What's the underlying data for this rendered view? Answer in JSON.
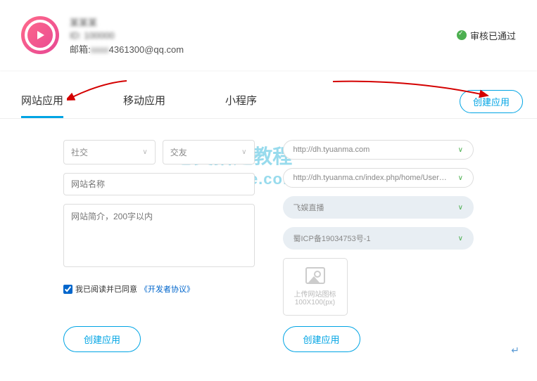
{
  "header": {
    "email_label": "邮箱:",
    "email": "4361300@qq.com",
    "status_text": "审核已通过",
    "blurred_line1": "某某某",
    "blurred_line2": "ID: 100000"
  },
  "tabs": {
    "web": "网站应用",
    "mobile": "移动应用",
    "miniapp": "小程序",
    "create": "创建应用"
  },
  "form": {
    "category1": "社交",
    "category2": "交友",
    "site_name_placeholder": "网站名称",
    "site_desc_placeholder": "网站简介，200字以内",
    "agree_prefix": "我已阅读并已同意",
    "agree_link": "《开发者协议》",
    "domain_value": "http://dh.tyuanma.com",
    "callback_value": "http://dh.tyuanma.cn/index.php/home/User/qqCallback;http://dh.tyuan",
    "app_value": "飞娱直播",
    "icp_value": "蜀ICP备19034753号-1",
    "upload_label1": "上传网站图标",
    "upload_label2": "100X100(px)",
    "submit": "创建应用"
  },
  "watermark": {
    "line1": "老吴搭建教程",
    "line2": "weixiaolive.com"
  }
}
